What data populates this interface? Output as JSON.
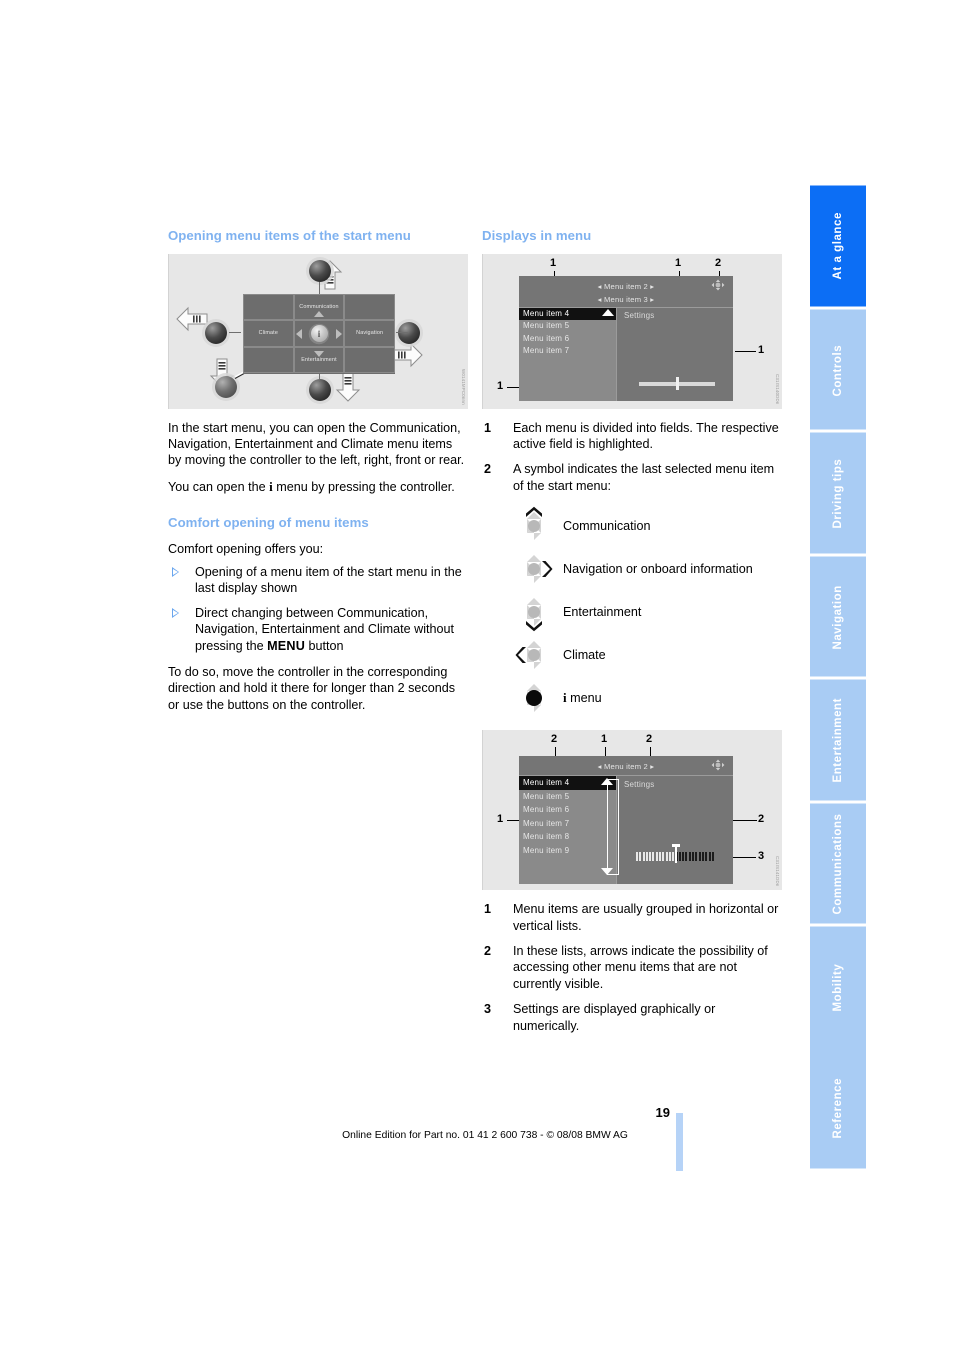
{
  "document": {
    "page_number": "19",
    "footer_text": "Online Edition for Part no. 01 41 2 600 738 - © 08/08 BMW AG"
  },
  "sidebar": {
    "tabs": [
      {
        "label": "At a glance",
        "active": true
      },
      {
        "label": "Controls",
        "active": false
      },
      {
        "label": "Driving tips",
        "active": false
      },
      {
        "label": "Navigation",
        "active": false
      },
      {
        "label": "Entertainment",
        "active": false
      },
      {
        "label": "Communications",
        "active": false
      },
      {
        "label": "Mobility",
        "active": false
      },
      {
        "label": "Reference",
        "active": false
      }
    ],
    "colors": {
      "active_bg": "#0c6ef5",
      "inactive_bg": "#a9ccf4",
      "text": "#ffffff"
    }
  },
  "colors": {
    "heading_blue": "#7fb2f0",
    "bullet_blue": "#6aa6ee",
    "figure_bg": "#e7e7e7",
    "screen_bg": "#757575"
  },
  "left_column": {
    "heading1": "Opening menu items of the start menu",
    "figure1": {
      "code": "W0141MPC0nnn",
      "cells": {
        "top": "Communication",
        "left": "Climate",
        "right": "Navigation",
        "bottom": "Entertainment",
        "center": "i"
      }
    },
    "para1": "In the start menu, you can open the Communication, Navigation, Entertainment and Climate menu items by moving the controller to the left, right, front or rear.",
    "para2_pre": "You can open the ",
    "para2_symbol": "i",
    "para2_post": " menu by pressing the controller.",
    "heading2": "Comfort opening of menu items",
    "para3": "Comfort opening offers you:",
    "bullets": [
      {
        "text": "Opening of a menu item of the start menu in the last display shown"
      },
      {
        "text_pre": "Direct changing between Communication, Navigation, Entertainment and Climate without pressing the ",
        "key": "MENU",
        "text_post": " button"
      }
    ],
    "para4": "To do so, move the controller in the corresponding direction and hold it there for longer than 2 seconds or use the buttons on the controller."
  },
  "right_column": {
    "heading1": "Displays in menu",
    "figure2": {
      "code": "C31IS140DDn",
      "top_items": [
        "Menu item 2",
        "Menu item 3"
      ],
      "list_items": [
        "Menu item 4",
        "Menu item 5",
        "Menu item 6",
        "Menu item 7"
      ],
      "selected_item": "Menu item 4",
      "right_panel_title": "Settings",
      "callouts": [
        "1",
        "1",
        "2",
        "1",
        "1"
      ]
    },
    "list1": [
      {
        "num": "1",
        "text": "Each menu is divided into fields. The respective active field is highlighted."
      },
      {
        "num": "2",
        "text": "A symbol indicates the last selected menu item of the start menu:"
      }
    ],
    "symbols": [
      {
        "icon": "controller-up-icon",
        "direction": "up",
        "label": "Communication"
      },
      {
        "icon": "controller-right-icon",
        "direction": "right",
        "label": "Navigation or onboard information"
      },
      {
        "icon": "controller-down-icon",
        "direction": "down",
        "label": "Entertainment"
      },
      {
        "icon": "controller-left-icon",
        "direction": "left",
        "label": "Climate"
      },
      {
        "icon": "controller-press-icon",
        "direction": "press",
        "label_symbol": "i",
        "label": " menu"
      }
    ],
    "figure3": {
      "code": "C31IS141DDn",
      "top_item": "Menu item 2",
      "list_items": [
        "Menu item 4",
        "Menu item 5",
        "Menu item 6",
        "Menu item 7",
        "Menu item 8",
        "Menu item 9"
      ],
      "selected_item": "Menu item 4",
      "right_panel_title": "Settings",
      "callouts": [
        "2",
        "1",
        "2",
        "1",
        "2",
        "3"
      ]
    },
    "list2": [
      {
        "num": "1",
        "text": "Menu items are usually grouped in horizontal or vertical lists."
      },
      {
        "num": "2",
        "text": "In these lists, arrows indicate the possibility of accessing other menu items that are not currently visible."
      },
      {
        "num": "3",
        "text": "Settings are displayed graphically or numerically."
      }
    ]
  }
}
